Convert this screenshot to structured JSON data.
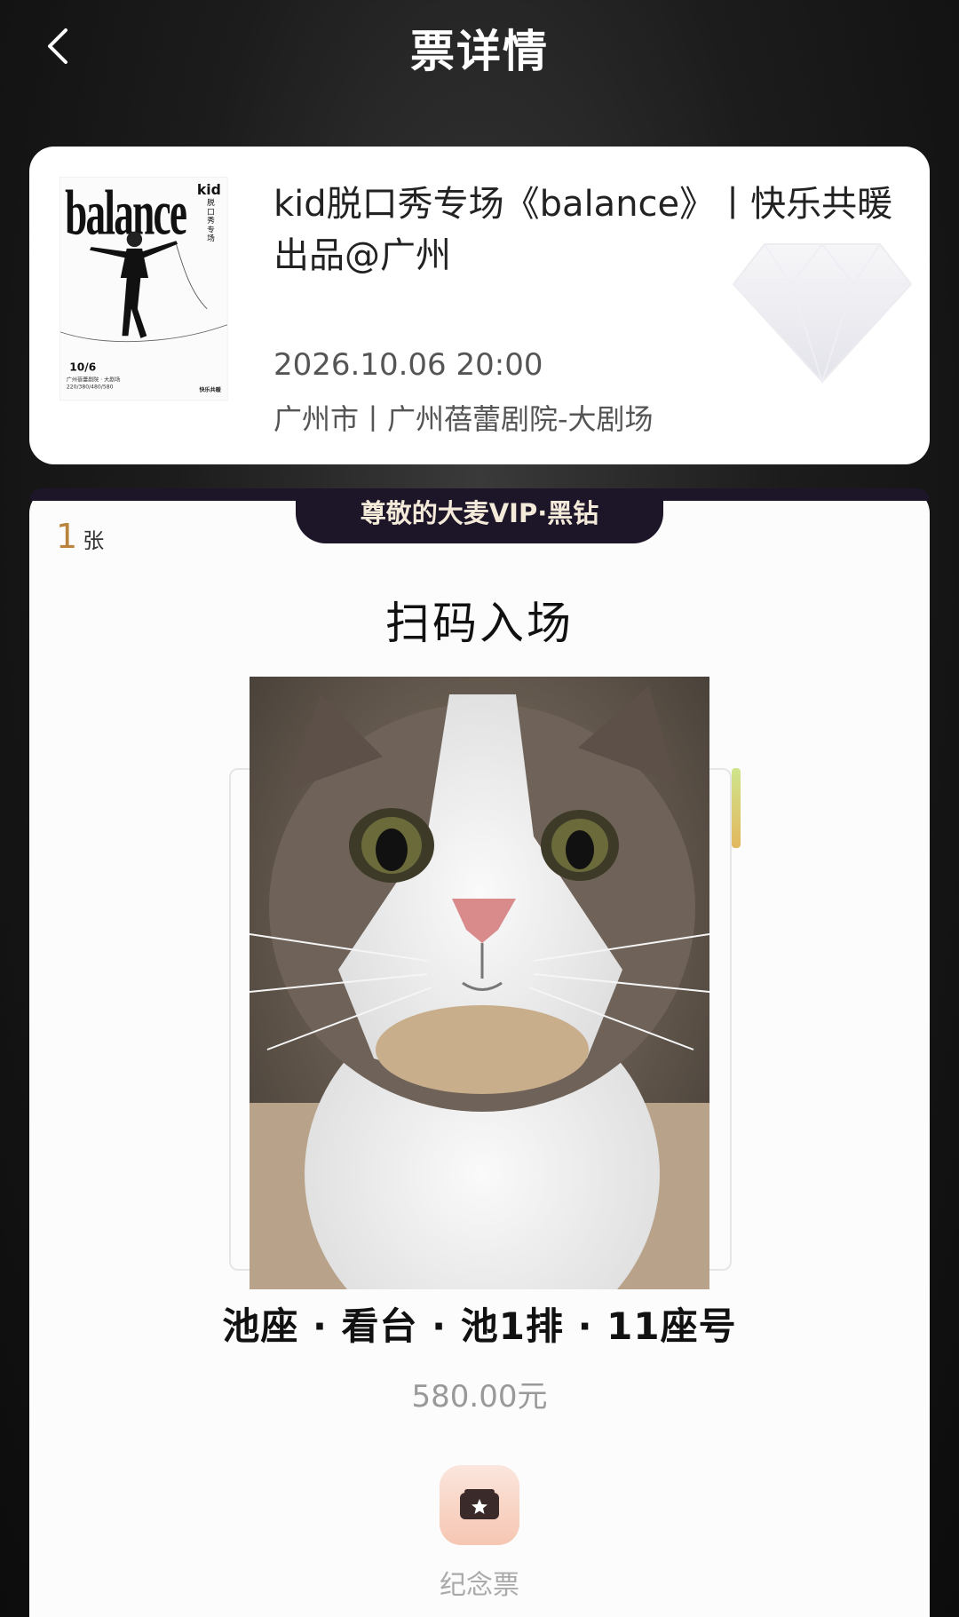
{
  "header": {
    "title": "票详情",
    "back_icon": "chevron-left-icon"
  },
  "event": {
    "title": "kid脱口秀专场《balance》丨快乐共暖出品@广州",
    "datetime": "2026.10.06 20:00",
    "venue": "广州市丨广州蓓蕾剧院-大剧场",
    "poster": {
      "headline": "balance",
      "kid": "kid",
      "subtitle": "脱口秀专场",
      "date": "10/6",
      "info_lines": [
        "广州蓓蕾剧院 · 大剧场",
        "220/380/480/580"
      ],
      "brand": "快乐共暖"
    }
  },
  "ticket": {
    "vip_badge": "尊敬的大麦VIP·黑钻",
    "count_number": "1",
    "count_unit": "张",
    "scan_title": "扫码入场",
    "seat_info": "池座 · 看台 · 池1排 · 11座号",
    "price": "580.00元",
    "souvenir_label": "纪念票"
  },
  "colors": {
    "vip_band": "#1d1528",
    "count_accent": "#b8833b",
    "souvenir_bg": "#f6c6b2"
  }
}
